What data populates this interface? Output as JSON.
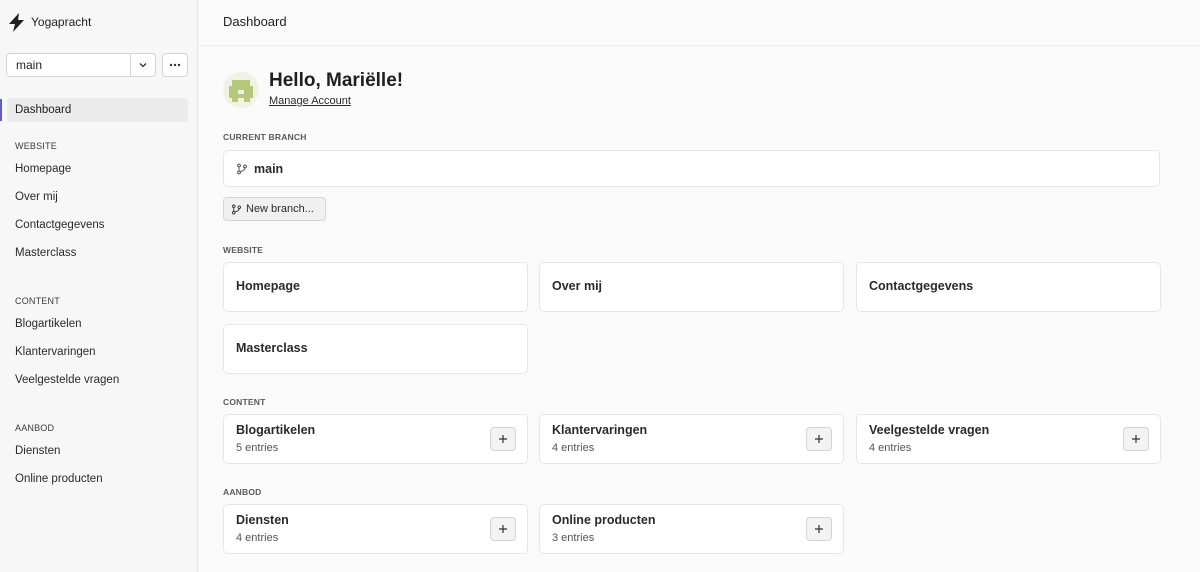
{
  "app": {
    "name": "Yogapracht",
    "logo_icon": "bolt-icon"
  },
  "branch_select": {
    "value": "main"
  },
  "sidebar": {
    "dashboard": "Dashboard",
    "sections": [
      {
        "title": "WEBSITE",
        "items": [
          "Homepage",
          "Over mij",
          "Contactgegevens",
          "Masterclass"
        ]
      },
      {
        "title": "CONTENT",
        "items": [
          "Blogartikelen",
          "Klantervaringen",
          "Veelgestelde vragen"
        ]
      },
      {
        "title": "AANBOD",
        "items": [
          "Diensten",
          "Online producten"
        ]
      }
    ]
  },
  "header": {
    "title": "Dashboard"
  },
  "user": {
    "greeting": "Hello, Mariëlle!",
    "manage_account": "Manage Account"
  },
  "current_branch": {
    "label": "CURRENT BRANCH",
    "name": "main",
    "new_branch_label": "New branch..."
  },
  "website": {
    "label": "WEBSITE",
    "pages": [
      "Homepage",
      "Over mij",
      "Contactgegevens",
      "Masterclass"
    ]
  },
  "content": {
    "label": "CONTENT",
    "collections": [
      {
        "name": "Blogartikelen",
        "count": "5 entries"
      },
      {
        "name": "Klantervaringen",
        "count": "4 entries"
      },
      {
        "name": "Veelgestelde vragen",
        "count": "4 entries"
      }
    ]
  },
  "aanbod": {
    "label": "AANBOD",
    "collections": [
      {
        "name": "Diensten",
        "count": "4 entries"
      },
      {
        "name": "Online producten",
        "count": "3 entries"
      }
    ]
  },
  "colors": {
    "accent": "#5b5bd6",
    "avatar": "#b5c77a"
  }
}
